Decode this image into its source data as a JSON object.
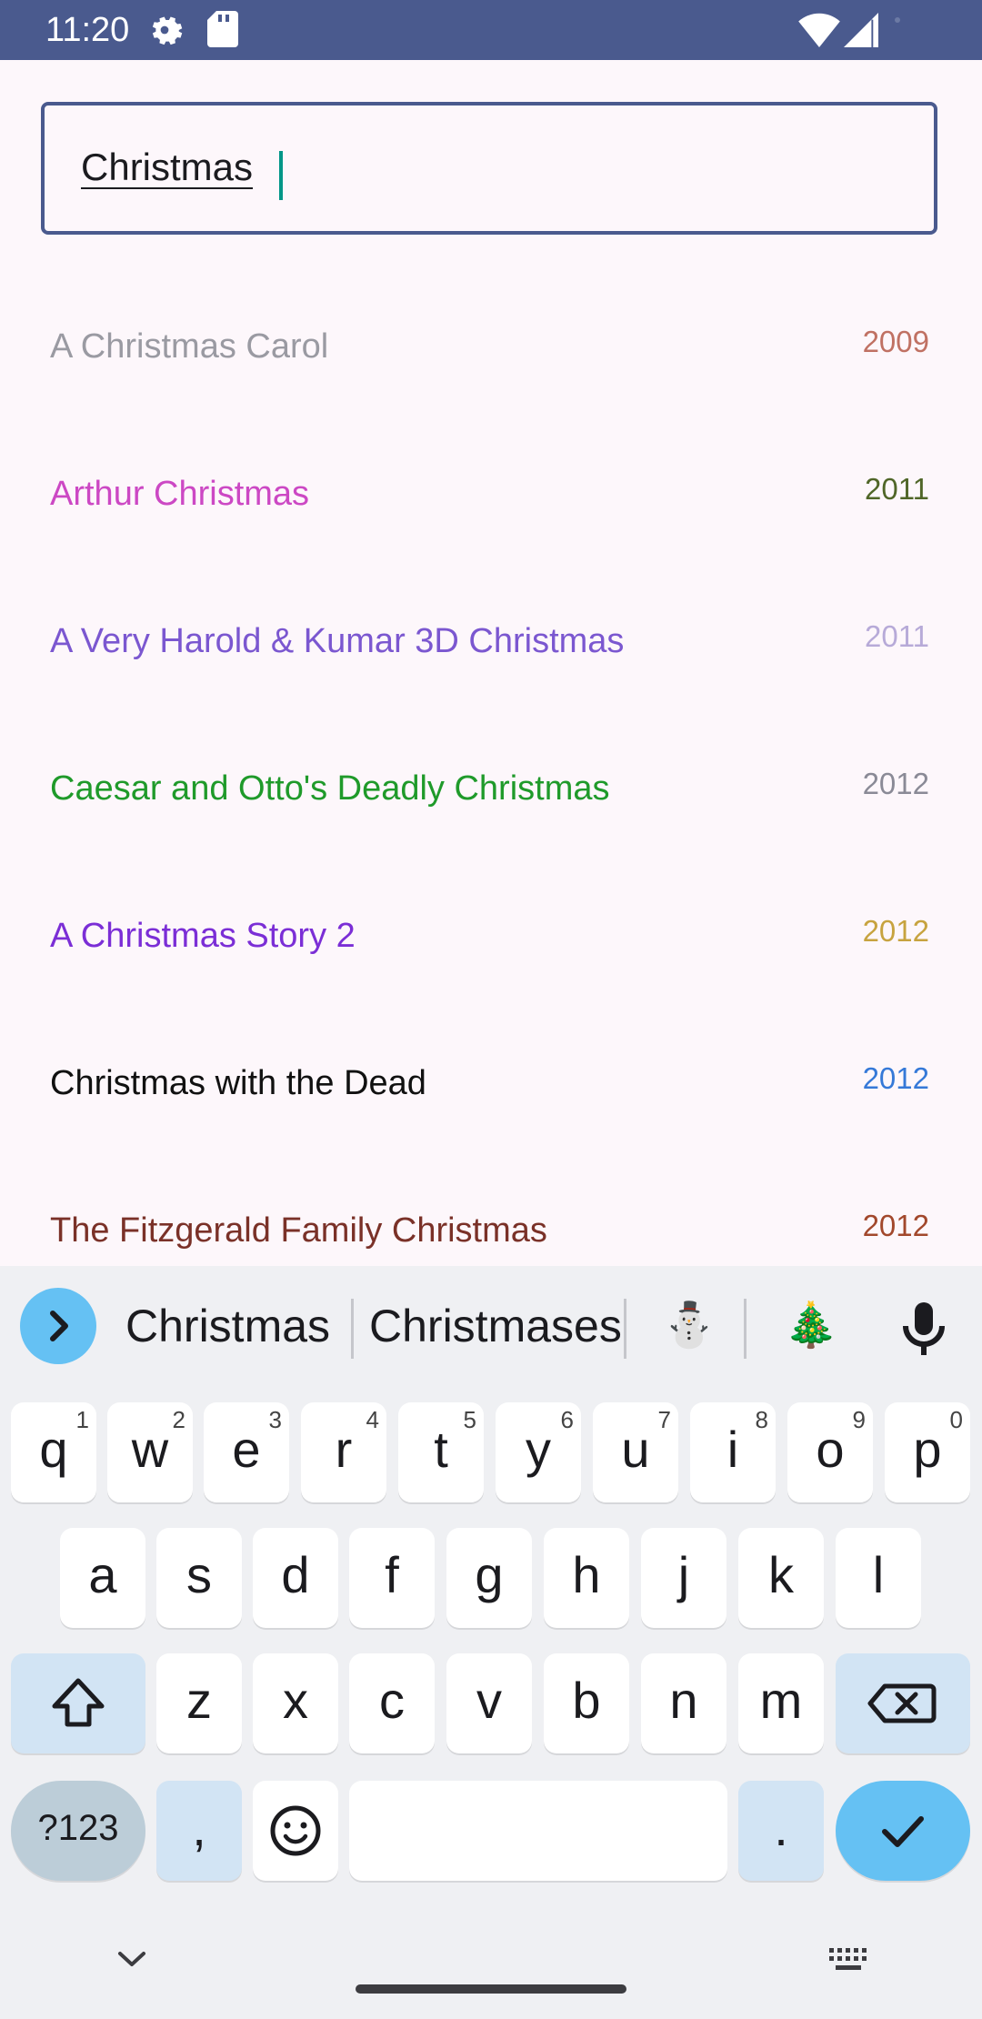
{
  "status_bar": {
    "time": "11:20"
  },
  "search": {
    "value": "Christmas"
  },
  "movies": [
    {
      "title": "A Christmas Carol",
      "year": "2009",
      "title_color": "#9a9aa2",
      "year_color": "#c07163"
    },
    {
      "title": "Arthur Christmas",
      "year": "2011",
      "title_color": "#cc48c4",
      "year_color": "#506628"
    },
    {
      "title": "A Very Harold & Kumar 3D Christmas",
      "year": "2011",
      "title_color": "#7b57d0",
      "year_color": "#b7aad8"
    },
    {
      "title": "Caesar and Otto's Deadly Christmas",
      "year": "2012",
      "title_color": "#1f9a2a",
      "year_color": "#8a8a96"
    },
    {
      "title": "A Christmas Story 2",
      "year": "2012",
      "title_color": "#7b2ed6",
      "year_color": "#c7a33f"
    },
    {
      "title": "Christmas with the Dead",
      "year": "2012",
      "title_color": "#111111",
      "year_color": "#3579d8"
    },
    {
      "title": "The Fitzgerald Family Christmas",
      "year": "2012",
      "title_color": "#7a3128",
      "year_color": "#a2482c"
    }
  ],
  "keyboard": {
    "suggestions": [
      "Christmas",
      "Christmases"
    ],
    "emoji_suggestions": [
      "⛄",
      "🎄"
    ],
    "row1": [
      {
        "k": "q",
        "h": "1"
      },
      {
        "k": "w",
        "h": "2"
      },
      {
        "k": "e",
        "h": "3"
      },
      {
        "k": "r",
        "h": "4"
      },
      {
        "k": "t",
        "h": "5"
      },
      {
        "k": "y",
        "h": "6"
      },
      {
        "k": "u",
        "h": "7"
      },
      {
        "k": "i",
        "h": "8"
      },
      {
        "k": "o",
        "h": "9"
      },
      {
        "k": "p",
        "h": "0"
      }
    ],
    "row2": [
      "a",
      "s",
      "d",
      "f",
      "g",
      "h",
      "j",
      "k",
      "l"
    ],
    "row3": [
      "z",
      "x",
      "c",
      "v",
      "b",
      "n",
      "m"
    ],
    "symbols_label": "?123",
    "comma": ",",
    "period": "."
  }
}
